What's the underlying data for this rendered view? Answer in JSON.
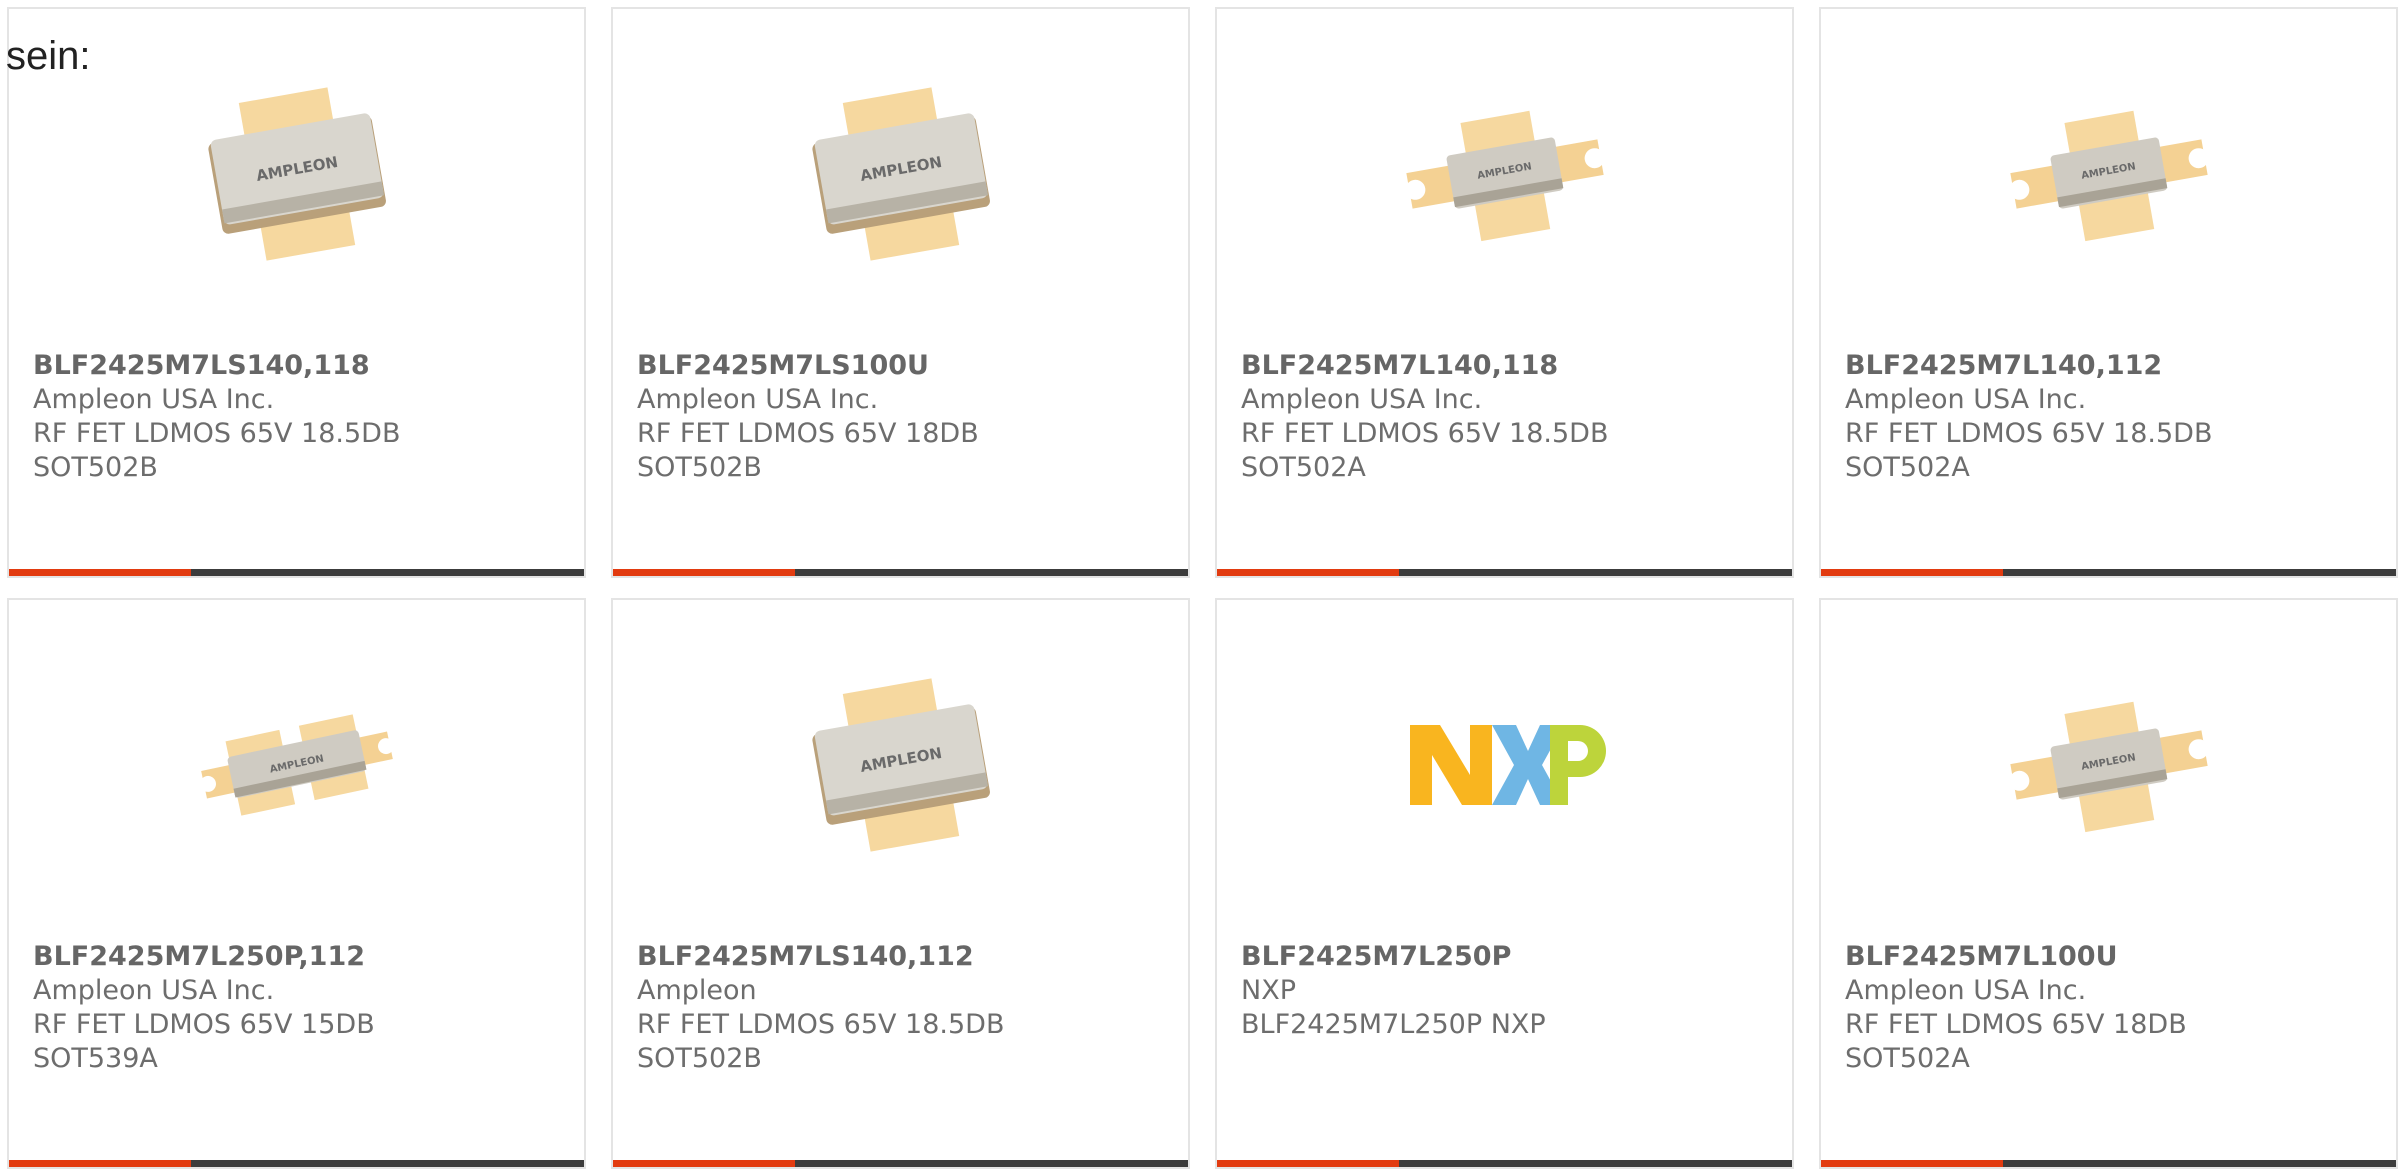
{
  "intro_text": "sein:",
  "colors": {
    "accent": "#e23b10",
    "bar": "#3c3c3c",
    "border": "#e4e4e4",
    "nxp_orange": "#f9b51f",
    "nxp_blue": "#6fb6e4",
    "nxp_green": "#bdd43b"
  },
  "products": [
    {
      "part": "BLF2425M7LS140,118",
      "manufacturer": "Ampleon USA Inc.",
      "description": "RF FET LDMOS 65V 18.5DB",
      "package": "SOT502B",
      "image": "ampleon-flange-large"
    },
    {
      "part": "BLF2425M7LS100U",
      "manufacturer": "Ampleon USA Inc.",
      "description": "RF FET LDMOS 65V 18DB",
      "package": "SOT502B",
      "image": "ampleon-flange-large"
    },
    {
      "part": "BLF2425M7L140,118",
      "manufacturer": "Ampleon USA Inc.",
      "description": "RF FET LDMOS 65V 18.5DB",
      "package": "SOT502A",
      "image": "ampleon-flange-eared"
    },
    {
      "part": "BLF2425M7L140,112",
      "manufacturer": "Ampleon USA Inc.",
      "description": "RF FET LDMOS 65V 18.5DB",
      "package": "SOT502A",
      "image": "ampleon-flange-eared"
    },
    {
      "part": "BLF2425M7L250P,112",
      "manufacturer": "Ampleon USA Inc.",
      "description": "RF FET LDMOS 65V 15DB",
      "package": "SOT539A",
      "image": "ampleon-flange-wide"
    },
    {
      "part": "BLF2425M7LS140,112",
      "manufacturer": "Ampleon",
      "description": "RF FET LDMOS 65V 18.5DB",
      "package": "SOT502B",
      "image": "ampleon-flange-large"
    },
    {
      "part": "BLF2425M7L250P",
      "manufacturer": "NXP",
      "description": "BLF2425M7L250P NXP",
      "package": "",
      "image": "nxp-logo"
    },
    {
      "part": "BLF2425M7L100U",
      "manufacturer": "Ampleon USA Inc.",
      "description": "RF FET LDMOS 65V 18DB",
      "package": "SOT502A",
      "image": "ampleon-flange-eared"
    }
  ]
}
